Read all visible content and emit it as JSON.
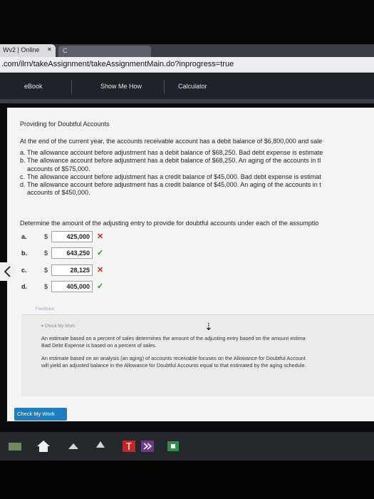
{
  "browser": {
    "tab_title": "Wv2 | Online",
    "tab_close": "×",
    "tab2_label": "C",
    "url": ".com/ilrn/takeAssignment/takeAssignmentMain.do?inprogress=true"
  },
  "toolbar": {
    "ebook": "eBook",
    "show_me_how": "Show Me How",
    "calculator": "Calculator"
  },
  "problem": {
    "title": "Providing for Doubtful Accounts",
    "intro": "At the end of the current year, the accounts receivable account has a debit balance of $6,800,000 and sale",
    "cases": [
      {
        "letter": "a.",
        "lines": [
          "The allowance account before adjustment has a debit balance of $68,250. Bad debt expense is estimate"
        ]
      },
      {
        "letter": "b.",
        "lines": [
          "The allowance account before adjustment has a debit balance of $68,250. An aging of the accounts in tl",
          "accounts of $575,000."
        ]
      },
      {
        "letter": "c.",
        "lines": [
          "The allowance account before adjustment has a credit balance of $45,000. Bad debt expense is estimat"
        ]
      },
      {
        "letter": "d.",
        "lines": [
          "The allowance account before adjustment has a credit balance of $45,000. An aging of the accounts in t",
          "accounts of $450,000."
        ]
      }
    ],
    "determine": "Determine the amount of the adjusting entry to provide for doubtful accounts under each of the assumptio"
  },
  "answers": [
    {
      "label": "a.",
      "currency": "$",
      "value": "425,000",
      "correct": false
    },
    {
      "label": "b.",
      "currency": "$",
      "value": "643,250",
      "correct": true
    },
    {
      "label": "c.",
      "currency": "$",
      "value": "28,125",
      "correct": false
    },
    {
      "label": "d.",
      "currency": "$",
      "value": "405,000",
      "correct": true
    }
  ],
  "marks": {
    "wrong": "✕",
    "right": "✓"
  },
  "feedback": {
    "label": "Feedback",
    "check_my_work": "▾ Check My Work",
    "p1_line1": "An estimate based on a percent of sales determines the amount of the adjusting entry based on the amount estima",
    "p1_line2": "Bad Debt Expense is based on a percent of sales.",
    "p2_line1": "An estimate based on an analysis (an aging) of accounts receivable focuses on the Allowance for Doubtful Account",
    "p2_line2": "will yield an adjusted balance in the Allowance for Doubtful Accounts equal to that estimated by the aging schedule."
  },
  "check_button": "Check My Work",
  "colors": {
    "wrong": "#d2232a",
    "right": "#2e8b2e",
    "button": "#1e7fc0"
  }
}
